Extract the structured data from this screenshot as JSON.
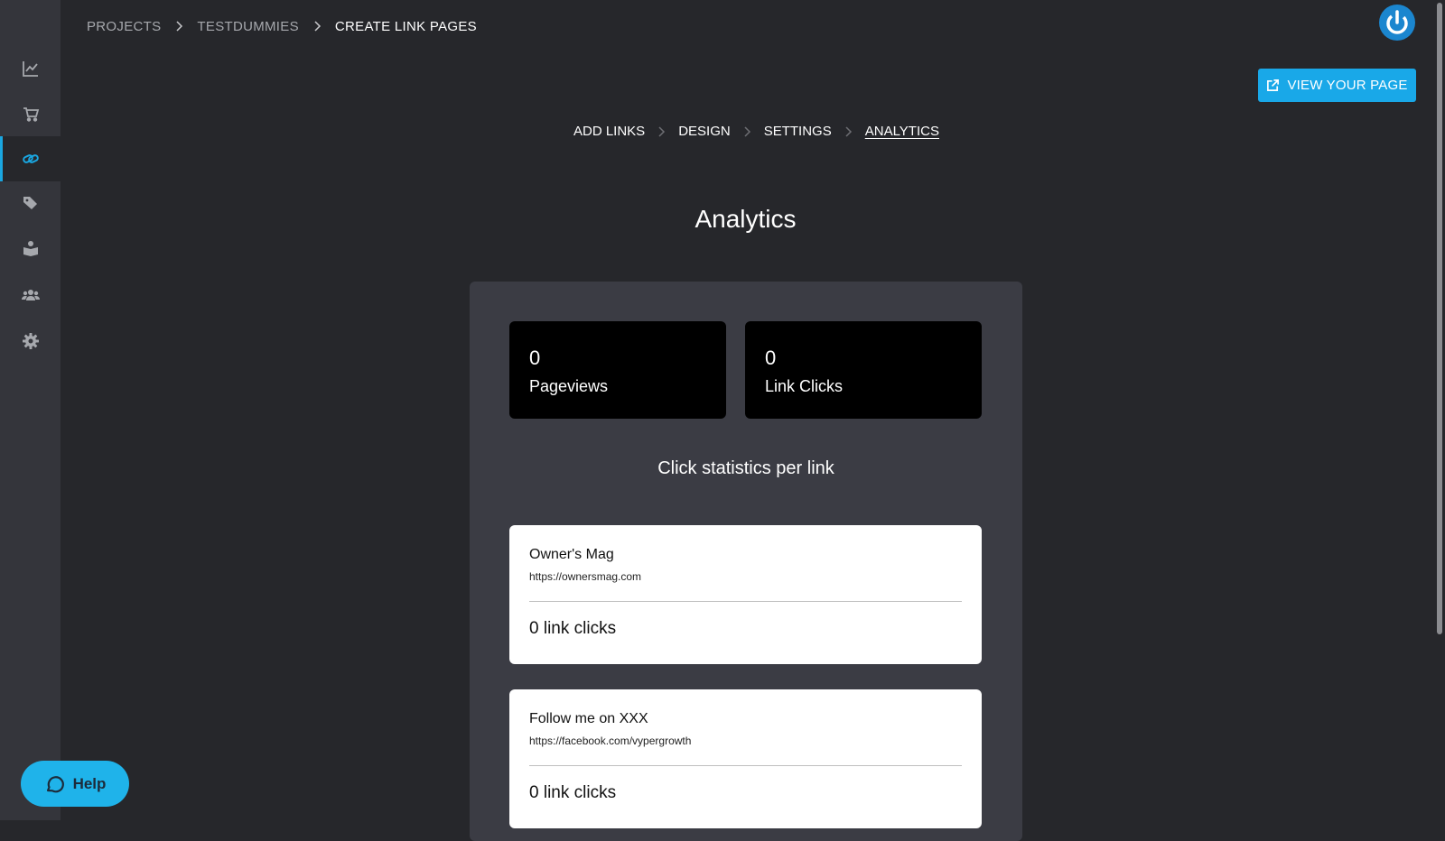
{
  "sidebar": {
    "items": [
      {
        "name": "analytics",
        "icon": "chart-line-icon"
      },
      {
        "name": "shop",
        "icon": "cart-icon"
      },
      {
        "name": "link-pages",
        "icon": "link-icon",
        "active": true
      },
      {
        "name": "tags",
        "icon": "tags-icon"
      },
      {
        "name": "library",
        "icon": "reader-icon"
      },
      {
        "name": "team",
        "icon": "users-icon"
      },
      {
        "name": "settings",
        "icon": "gear-icon"
      }
    ]
  },
  "breadcrumb": {
    "projects": "PROJECTS",
    "project": "TESTDUMMIES",
    "current": "CREATE LINK PAGES"
  },
  "header": {
    "view_page_label": "VIEW YOUR PAGE"
  },
  "steps": {
    "add_links": "ADD LINKS",
    "design": "DESIGN",
    "settings": "SETTINGS",
    "analytics": "ANALYTICS"
  },
  "page_title": "Analytics",
  "stats": {
    "pageviews": {
      "value": "0",
      "label": "Pageviews"
    },
    "link_clicks": {
      "value": "0",
      "label": "Link Clicks"
    }
  },
  "per_link_title": "Click statistics per link",
  "links": [
    {
      "name": "Owner's Mag",
      "url": "https://ownersmag.com",
      "clicks": "0 link clicks"
    },
    {
      "name": "Follow me on XXX",
      "url": "https://facebook.com/vypergrowth",
      "clicks": "0 link clicks"
    }
  ],
  "help": {
    "label": "Help"
  },
  "colors": {
    "accent": "#19a8e8",
    "background": "#26272b",
    "sidebar": "#34353b",
    "panel": "#3b3c44"
  }
}
